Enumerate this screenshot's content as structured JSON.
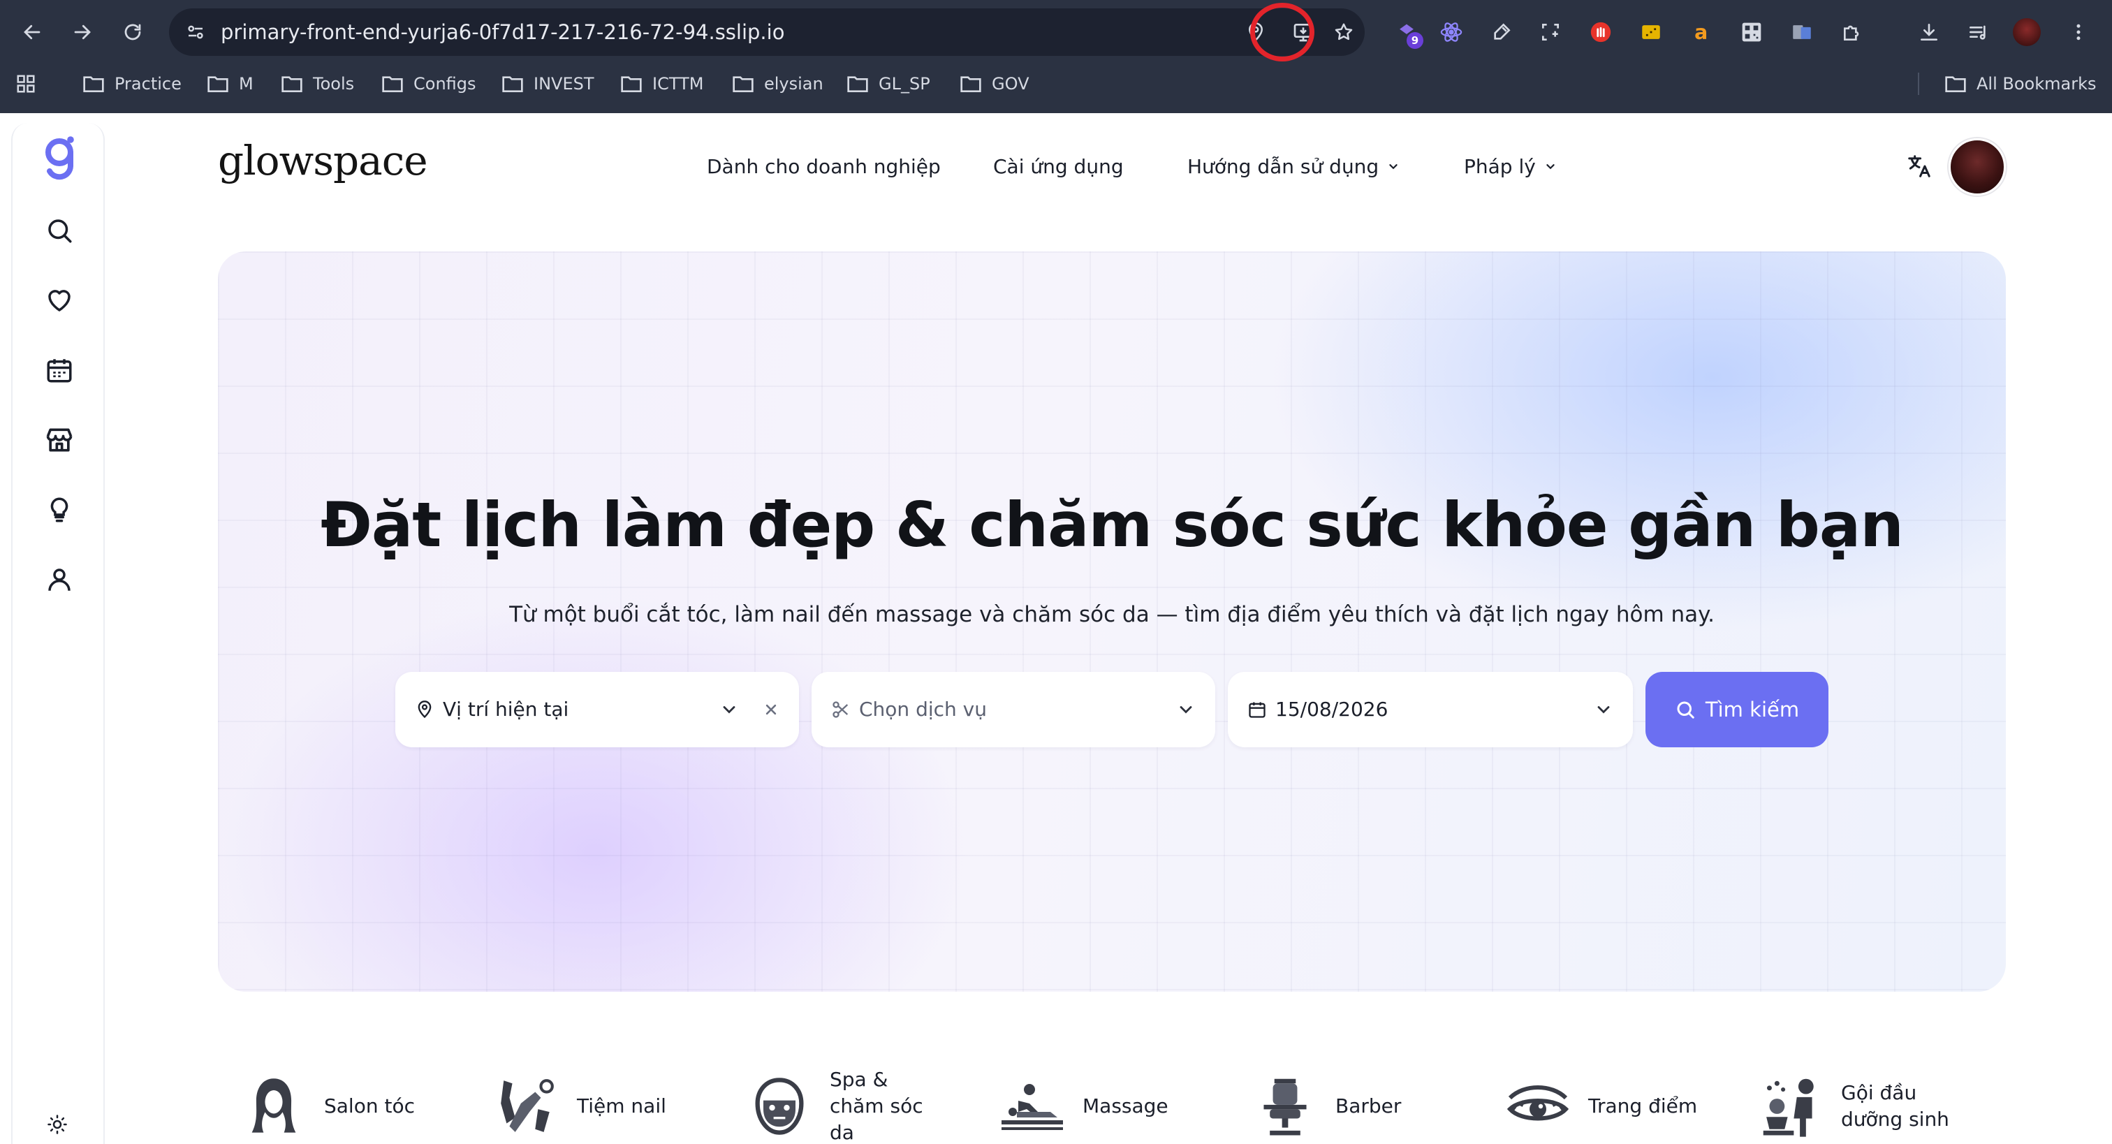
{
  "browser": {
    "url": "primary-front-end-yurja6-0f7d17-217-216-72-94.sslip.io",
    "extension_badge": "9",
    "bookmarks": [
      "Practice",
      "M",
      "Tools",
      "Configs",
      "INVEST",
      "ICTTM",
      "elysian",
      "GL_SP",
      "GOV"
    ],
    "all_bookmarks": "All Bookmarks"
  },
  "sidebar": {
    "items": [
      "search-icon",
      "heart-icon",
      "calendar-icon",
      "store-icon",
      "lightbulb-icon",
      "user-icon"
    ]
  },
  "header": {
    "logo": "glowspace",
    "nav": [
      "Dành cho doanh nghiệp",
      "Cài ứng dụng",
      "Hướng dẫn sử dụng",
      "Pháp lý"
    ]
  },
  "hero": {
    "title": "Đặt lịch làm đẹp & chăm sóc sức khỏe gần bạn",
    "subtitle": "Từ một buổi cắt tóc, làm nail đến massage và chăm sóc da — tìm địa điểm yêu thích và đặt lịch ngay hôm nay.",
    "location": "Vị trí hiện tại",
    "service_placeholder": "Chọn dịch vụ",
    "date": "15/08/2026",
    "search_label": "Tìm kiếm"
  },
  "categories": [
    {
      "label": "Salon tóc"
    },
    {
      "label": "Tiệm nail"
    },
    {
      "label": "Spa &\nchăm sóc\nda"
    },
    {
      "label": "Massage"
    },
    {
      "label": "Barber"
    },
    {
      "label": "Trang điểm"
    },
    {
      "label": "Gội đầu\ndưỡng sinh"
    }
  ],
  "colors": {
    "accent": "#6b6ff2",
    "logo_mark": "#6b6ff2",
    "chrome_bg": "#2b3242",
    "highlight_ring": "#e3242b"
  }
}
